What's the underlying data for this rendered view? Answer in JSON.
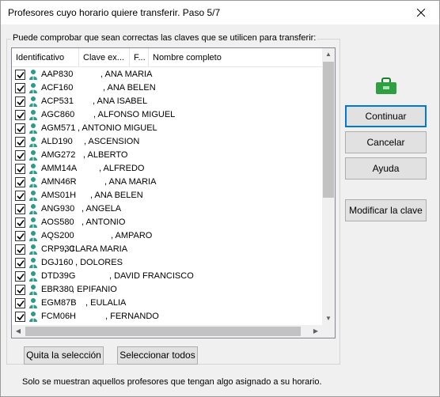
{
  "window": {
    "title": "Profesores cuyo horario quiere transferir. Paso 5/7"
  },
  "group": {
    "label": "Puede comprobar que sean correctas las claves que se utilicen para transferir:"
  },
  "list": {
    "columns": [
      "Identificativo",
      "Clave ex...",
      "F...",
      "Nombre completo"
    ],
    "rows": [
      {
        "code": "AAP830",
        "name": ", ANA MARIA",
        "checked": true
      },
      {
        "code": "ACF160",
        "name": ", ANA BELEN",
        "checked": true
      },
      {
        "code": "ACP531",
        "name": ", ANA ISABEL",
        "checked": true
      },
      {
        "code": "AGC860",
        "name": ", ALFONSO MIGUEL",
        "checked": true
      },
      {
        "code": "AGM571",
        "name": ", ANTONIO MIGUEL",
        "checked": true
      },
      {
        "code": "ALD190",
        "name": ", ASCENSION",
        "checked": true
      },
      {
        "code": "AMG272",
        "name": ", ALBERTO",
        "checked": true
      },
      {
        "code": "AMM14A",
        "name": ", ALFREDO",
        "checked": true
      },
      {
        "code": "AMN46R",
        "name": ", ANA MARIA",
        "checked": true
      },
      {
        "code": "AMS01H",
        "name": ", ANA BELEN",
        "checked": true
      },
      {
        "code": "ANG930",
        "name": ", ANGELA",
        "checked": true
      },
      {
        "code": "AOS580",
        "name": ", ANTONIO",
        "checked": true
      },
      {
        "code": "AQS200",
        "name": ", AMPARO",
        "checked": true
      },
      {
        "code": "CRP930",
        "name": ", CLARA MARIA",
        "checked": true
      },
      {
        "code": "DGJ160",
        "name": ", DOLORES",
        "checked": true
      },
      {
        "code": "DTD39G",
        "name": ", DAVID FRANCISCO",
        "checked": true
      },
      {
        "code": "EBR380",
        "name": ", EPIFANIO",
        "checked": true
      },
      {
        "code": "EGM87B",
        "name": ", EULALIA",
        "checked": true
      },
      {
        "code": "FCM06H",
        "name": ", FERNANDO",
        "checked": true
      }
    ]
  },
  "buttons": {
    "continuar": "Continuar",
    "cancelar": "Cancelar",
    "ayuda": "Ayuda",
    "modificar": "Modificar la clave",
    "quitar": "Quita la selección",
    "seleccionar": "Seleccionar todos"
  },
  "footer": {
    "note": "Solo se muestran aquellos profesores que tengan algo asignado a su horario."
  },
  "colors": {
    "accent": "#0078d7",
    "person_icon": "#2e9a8a",
    "bag_icon": "#2ea043"
  }
}
